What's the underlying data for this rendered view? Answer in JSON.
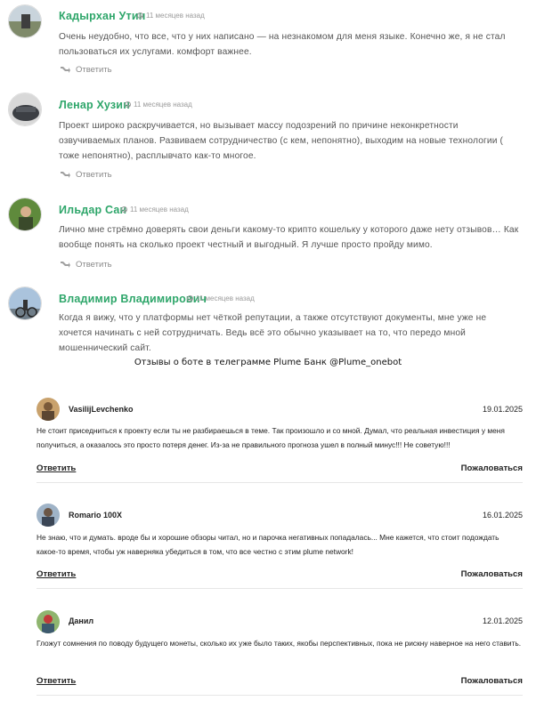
{
  "comments": [
    {
      "author": "Кадырхан Утин",
      "time": "11 месяцев назад",
      "text": "Очень неудобно, что все, что у них написано — на незнакомом для меня языке. Конечно же, я не стал пользоваться их услугами. комфорт важнее.",
      "reply": "Ответить"
    },
    {
      "author": "Ленар Хузин",
      "time": "11 месяцев назад",
      "text": "Проект широко раскручивается, но вызывает массу подозрений по причине неконкретности озвучиваемых планов. Развиваем сотрудничество (с кем, непонятно), выходим на новые технологии ( тоже непонятно), расплывчато как-то многое.",
      "reply": "Ответить"
    },
    {
      "author": "Ильдар Сан",
      "time": "11 месяцев назад",
      "text": "Лично мне стрёмно доверять свои деньги какому-то крипто кошельку у которого даже нету отзывов… Как вообще понять на сколько проект честный и выгодный. Я лучше просто пройду мимо.",
      "reply": "Ответить"
    },
    {
      "author": "Владимир Владимирович",
      "time": "11 месяцев назад",
      "text": "Когда я вижу, что у платформы нет чёткой репутации, а также отсутствуют документы, мне уже не хочется начинать с ней сотрудничать. Ведь всё это обычно указывает на то, что передо мной мошеннический сайт."
    }
  ],
  "note": "Отзывы о боте в телеграмме Plume Банк @Plume_onebot",
  "reviews": [
    {
      "author": "VasilijLevchenko",
      "date": "19.01.2025",
      "text": "Не стоит приседниться к проекту если ты не разбираешься в теме. Так произошло и со мной. Думал, что реальная инвестиция у меня получиться, а оказалось это просто потеря денег. Из-за не правильного прогноза ушел в полный минус!!! Не советую!!!",
      "reply": "Ответить",
      "report": "Пожаловаться"
    },
    {
      "author": "Romario 100X",
      "date": "16.01.2025",
      "text": "Не знаю, что и думать. вроде бы и хорошие обзоры читал, но и парочка негативных попадалась... Мне кажется, что стоит подождать какое-то время, чтобы уж наверняка убедиться в том, что все честно с этим plume network!",
      "reply": "Ответить",
      "report": "Пожаловаться"
    },
    {
      "author": "Данил",
      "date": "12.01.2025",
      "text": "Гложут сомнения по поводу будущего монеты, сколько их уже было таких, якобы перспективных, пока не рискну наверное на него ставить.",
      "reply": "Ответить",
      "report": "Пожаловаться"
    }
  ]
}
